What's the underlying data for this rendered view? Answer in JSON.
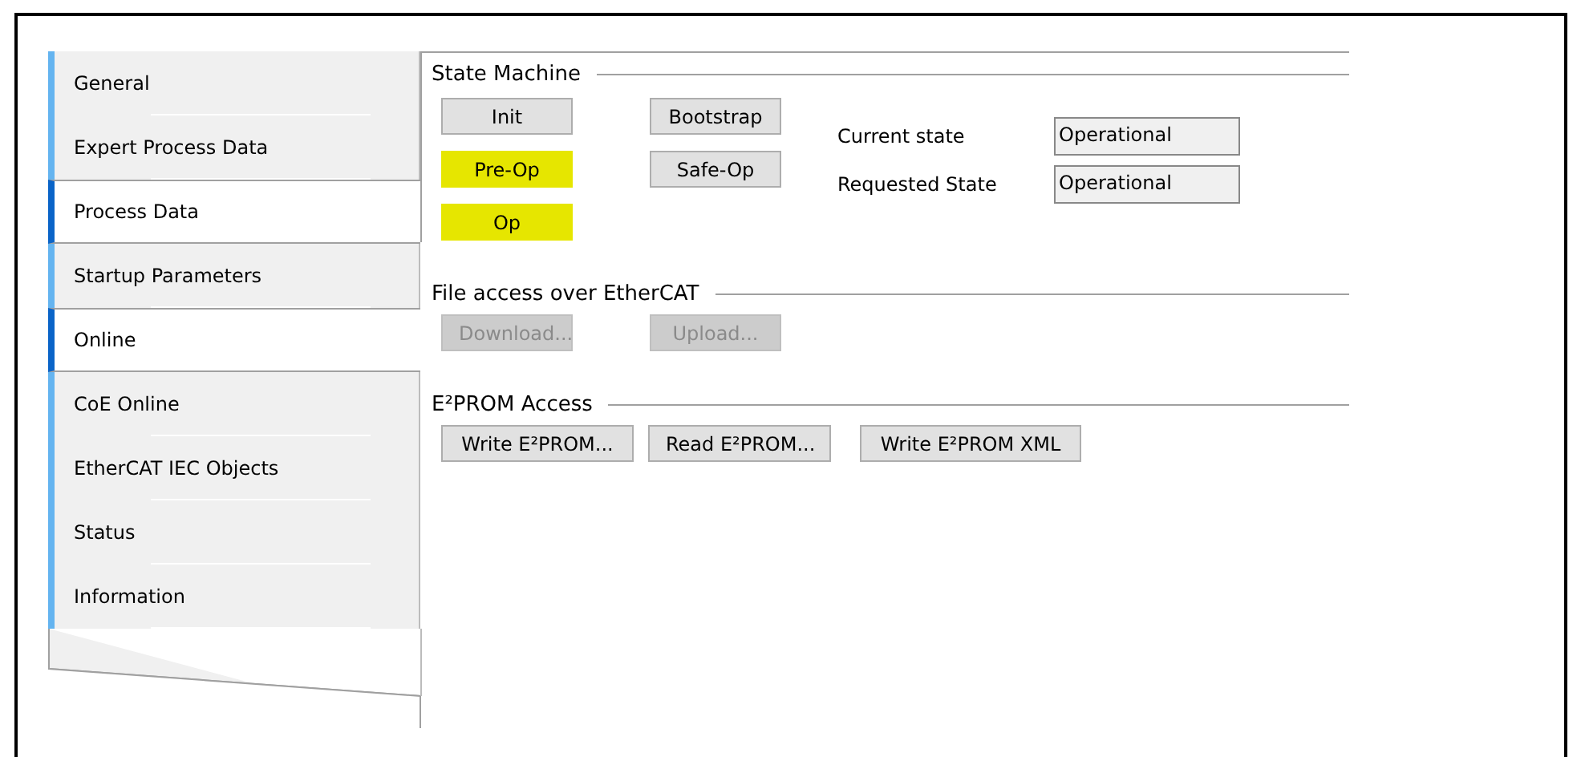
{
  "sidebar": {
    "items": [
      {
        "label": "General",
        "selected": false
      },
      {
        "label": "Expert Process Data",
        "selected": false
      },
      {
        "label": "Process Data",
        "selected": true
      },
      {
        "label": "Startup Parameters",
        "selected": false
      },
      {
        "label": "Online",
        "selected": true
      },
      {
        "label": "CoE Online",
        "selected": false
      },
      {
        "label": "EtherCAT IEC Objects",
        "selected": false
      },
      {
        "label": "Status",
        "selected": false
      },
      {
        "label": "Information",
        "selected": false
      }
    ]
  },
  "state_machine": {
    "title": "State Machine",
    "buttons": [
      {
        "label": "Init",
        "highlighted": false
      },
      {
        "label": "Bootstrap",
        "highlighted": false
      },
      {
        "label": "Pre-Op",
        "highlighted": true
      },
      {
        "label": "Safe-Op",
        "highlighted": false
      },
      {
        "label": "Op",
        "highlighted": true
      }
    ],
    "fields": [
      {
        "label": "Current state",
        "value": "Operational"
      },
      {
        "label": "Requested State",
        "value": "Operational"
      }
    ]
  },
  "file_access": {
    "title": "File access over EtherCAT",
    "buttons": [
      {
        "label": "Download...",
        "disabled": true
      },
      {
        "label": "Upload...",
        "disabled": true
      }
    ]
  },
  "eeprom": {
    "title": "E²PROM Access",
    "buttons": [
      {
        "label": "Write E²PROM...",
        "disabled": false
      },
      {
        "label": "Read E²PROM...",
        "disabled": false
      },
      {
        "label": "Write E²PROM XML",
        "disabled": false
      }
    ]
  }
}
